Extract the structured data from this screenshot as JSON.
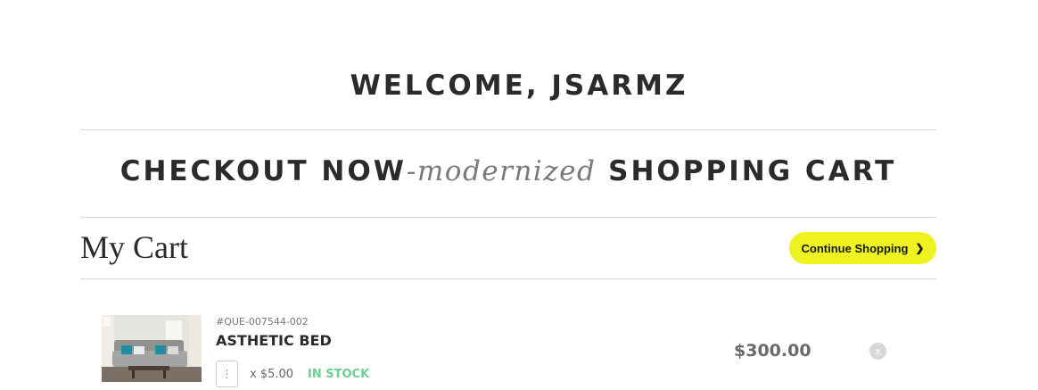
{
  "welcome": "WELCOME, JSARMZ",
  "headline": {
    "part1": "CHECKOUT NOW",
    "part2": "-modernized",
    "part3": " SHOPPING CART"
  },
  "cart": {
    "title": "My Cart",
    "continue_label": "Continue Shopping",
    "continue_icon": "chevron-right-icon"
  },
  "items": [
    {
      "sku": "#QUE-007544-002",
      "name": "ASTHETIC BED",
      "qty": "",
      "unit_price": "x $5.00",
      "stock": "IN STOCK",
      "total": "$300.00",
      "remove_label": "x",
      "image": "sofa-living-room-photo"
    }
  ],
  "colors": {
    "accent_button": "#eef21e",
    "in_stock": "#6ccf95",
    "divider": "#d6d6d6"
  }
}
